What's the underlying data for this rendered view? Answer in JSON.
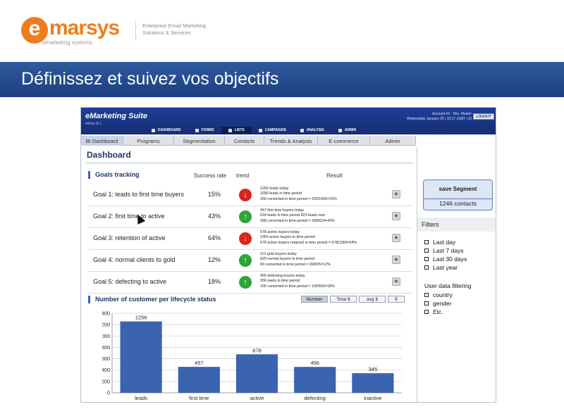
{
  "slide": {
    "logo_mark": "e",
    "logo_word": "marsys",
    "logo_subtitle": "emarketing systems",
    "logo_tagline": "Enterprise Email Marketing Solutions & Services",
    "title": "Définissez et suivez vos objectifs"
  },
  "app": {
    "suite_title": "eMarketing Suite",
    "suite_subtitle": "Admin B.1",
    "account_line1": "Account #2 - Mrs. Muster",
    "account_line2": "Wednesday January 25 | 15:17 (GMT +2)",
    "logout_label": "LOGOUT",
    "main_nav": [
      {
        "label": "DASHBOARD"
      },
      {
        "label": "FORMS"
      },
      {
        "label": "LISTS"
      },
      {
        "label": "CAMPAIGNS"
      },
      {
        "label": "ANALYSIS"
      },
      {
        "label": "ADMIN"
      }
    ],
    "tabs": [
      "BI Dashboard",
      "Programs",
      "Segmentation",
      "Contacts",
      "Trends & Analysis",
      "E-commerce",
      "Admin"
    ],
    "page_title": "Dashboard"
  },
  "goals": {
    "section_title": "Goals tracking",
    "col_rate": "Success rate",
    "col_trend": "trend",
    "col_result": "Result",
    "rows": [
      {
        "label": "Goal 1: leads to first time buyers",
        "rate": "15%",
        "trend": "down",
        "trend_glyph": "↓",
        "result": [
          "1256 leads today",
          "1656 leads in time period",
          "250 converted in time period = 250/1656=15%"
        ]
      },
      {
        "label": "Goal 2: first time to active",
        "rate": "43%",
        "trend": "up",
        "trend_glyph": "↑",
        "result": [
          "457 first time buyers today",
          "624 leads in time period 823 leads now",
          "268 converted in time period = 268/624=43%"
        ]
      },
      {
        "label": "Goal 3: retention of active",
        "rate": "64%",
        "trend": "down",
        "trend_glyph": "↓",
        "result": [
          "678 active buyers today",
          "1059 active buyers in time period",
          "678 active buyers retained  in time period = 678/1059=64%"
        ]
      },
      {
        "label": "Goal 4: normal clients to gold",
        "rate": "12%",
        "trend": "up",
        "trend_glyph": "↑",
        "result": [
          "112 gold buyers today",
          "825 normal buyers in time period",
          "99 converted in time period = 99/825=12%"
        ]
      },
      {
        "label": "Goal 5: defecting to active",
        "rate": "18%",
        "trend": "up",
        "trend_glyph": "↑",
        "result": [
          "456 defecting buyers today",
          "556 leads in time period",
          "100 converted in time period = 100/556=18%"
        ]
      }
    ]
  },
  "chart_section": {
    "title": "Number of customer per lifecycle status",
    "toggles": [
      "Number",
      "Total $",
      "avg $",
      "⚲"
    ]
  },
  "chart_data": {
    "type": "bar",
    "categories": [
      "leads",
      "first time",
      "active",
      "defecting",
      "inactive"
    ],
    "values": [
      1256,
      457,
      678,
      456,
      345
    ],
    "ylim": [
      0,
      1400
    ],
    "yticks": [
      0,
      200,
      400,
      600,
      800,
      1000,
      1200,
      1400
    ],
    "grid": true,
    "bar_color": "#3b64b0"
  },
  "right_panel": {
    "save_label": "save Segment",
    "contacts": "1246 contacts",
    "filters_title": "Filters",
    "filters": [
      "Last day",
      "Last 7 days",
      "Last 30 days",
      "Last year"
    ],
    "user_filter_title": "User data filtering",
    "user_filters": [
      "country",
      "gender",
      "Etc."
    ]
  },
  "colors": {
    "brand_orange": "#ef7d1e",
    "banner_blue": "#1c3f80",
    "trend_down": "#d6261e",
    "trend_up": "#2fa43a"
  }
}
